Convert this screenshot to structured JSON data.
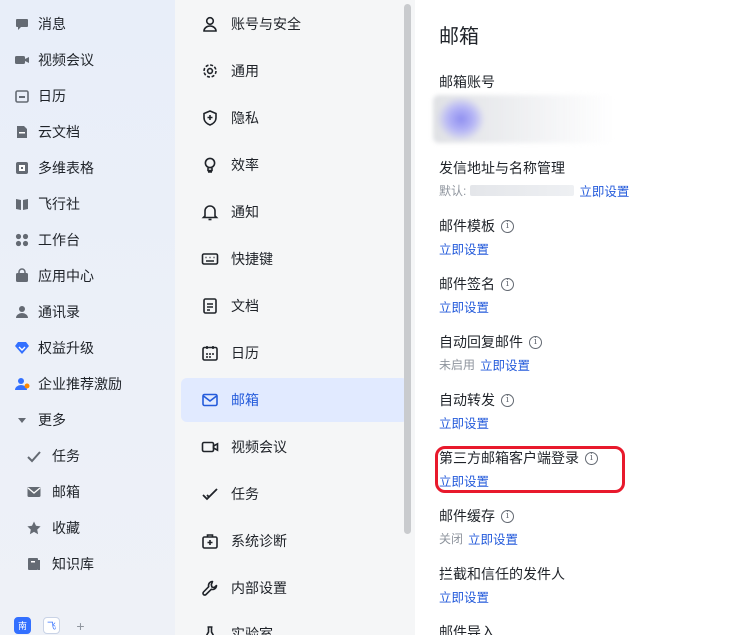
{
  "nav": {
    "items": [
      {
        "label": "消息",
        "icon": "message-icon"
      },
      {
        "label": "视频会议",
        "icon": "video-icon"
      },
      {
        "label": "日历",
        "icon": "calendar-icon"
      },
      {
        "label": "云文档",
        "icon": "doc-icon"
      },
      {
        "label": "多维表格",
        "icon": "base-icon"
      },
      {
        "label": "飞行社",
        "icon": "book-icon"
      },
      {
        "label": "工作台",
        "icon": "apps-icon"
      },
      {
        "label": "应用中心",
        "icon": "bag-icon"
      },
      {
        "label": "通讯录",
        "icon": "contacts-icon"
      },
      {
        "label": "权益升级",
        "icon": "diamond-icon"
      },
      {
        "label": "企业推荐激励",
        "icon": "referral-icon"
      },
      {
        "label": "更多",
        "icon": "caret-down-icon"
      }
    ],
    "sub_items": [
      {
        "label": "任务",
        "icon": "task-check-icon"
      },
      {
        "label": "邮箱",
        "icon": "mail-icon"
      },
      {
        "label": "收藏",
        "icon": "star-icon"
      },
      {
        "label": "知识库",
        "icon": "wiki-icon"
      }
    ],
    "bottom_apps": [
      "南",
      "飞",
      "+"
    ]
  },
  "settings_menu": {
    "items": [
      {
        "label": "账号与安全",
        "icon": "user-icon"
      },
      {
        "label": "通用",
        "icon": "gear-icon"
      },
      {
        "label": "隐私",
        "icon": "shield-icon"
      },
      {
        "label": "效率",
        "icon": "bulb-icon"
      },
      {
        "label": "通知",
        "icon": "bell-icon"
      },
      {
        "label": "快捷键",
        "icon": "keyboard-icon"
      },
      {
        "label": "文档",
        "icon": "document-icon"
      },
      {
        "label": "日历",
        "icon": "calendar-icon"
      },
      {
        "label": "邮箱",
        "icon": "mail-icon"
      },
      {
        "label": "视频会议",
        "icon": "video-icon"
      },
      {
        "label": "任务",
        "icon": "task-check-icon"
      },
      {
        "label": "系统诊断",
        "icon": "medkit-icon"
      },
      {
        "label": "内部设置",
        "icon": "wrench-icon"
      },
      {
        "label": "实验室",
        "icon": "flask-icon"
      }
    ],
    "active_index": 8
  },
  "content": {
    "title": "邮箱",
    "account_label": "邮箱账号",
    "sender": {
      "title": "发信地址与名称管理",
      "default_prefix": "默认:",
      "link": "立即设置"
    },
    "template": {
      "title": "邮件模板",
      "link": "立即设置"
    },
    "signature": {
      "title": "邮件签名",
      "link": "立即设置"
    },
    "auto_reply": {
      "title": "自动回复邮件",
      "status": "未启用",
      "link": "立即设置"
    },
    "forward": {
      "title": "自动转发",
      "link": "立即设置"
    },
    "third_party": {
      "title": "第三方邮箱客户端登录",
      "link": "立即设置"
    },
    "cache": {
      "title": "邮件缓存",
      "status": "关闭",
      "link": "立即设置"
    },
    "senders": {
      "title": "拦截和信任的发件人",
      "link": "立即设置"
    },
    "import": {
      "title": "邮件导入"
    },
    "info_glyph": "i"
  },
  "colors": {
    "accent": "#245bdb",
    "active_bg": "#e1eaff",
    "highlight": "#e8192c"
  }
}
